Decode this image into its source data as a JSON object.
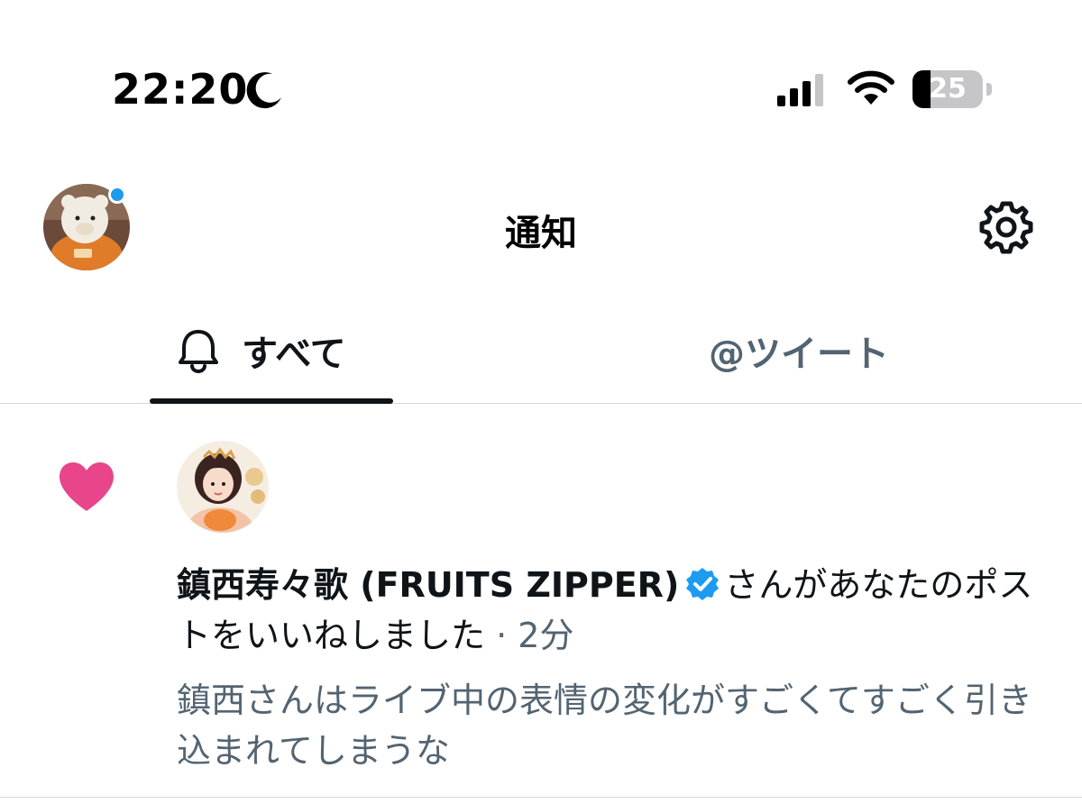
{
  "status_bar": {
    "time": "22:20",
    "battery_level": 25,
    "battery_label": "25",
    "moon_icon": "moon-icon",
    "signal_icon": "cellular-signal-icon",
    "wifi_icon": "wifi-icon"
  },
  "header": {
    "title": "通知",
    "settings_icon": "gear-icon"
  },
  "tabs": [
    {
      "label": "すべて",
      "icon": "bell-icon",
      "selected": true
    },
    {
      "label": "@ツイート",
      "selected": false
    }
  ],
  "notification": {
    "type_icon": "heart-icon",
    "user_name": "鎮西寿々歌 (FRUITS ZIPPER)",
    "verified": true,
    "action_text": "さんがあなたのポストをいいねしました",
    "separator": " · ",
    "time": "2分",
    "post_text": "鎮西さんはライブ中の表情の変化がすごくてすごく引き込まれてしまうな"
  },
  "colors": {
    "accent": "#1d9bf0",
    "like": "#f91880",
    "secondary_text": "#536471",
    "primary_text": "#0f1419"
  }
}
